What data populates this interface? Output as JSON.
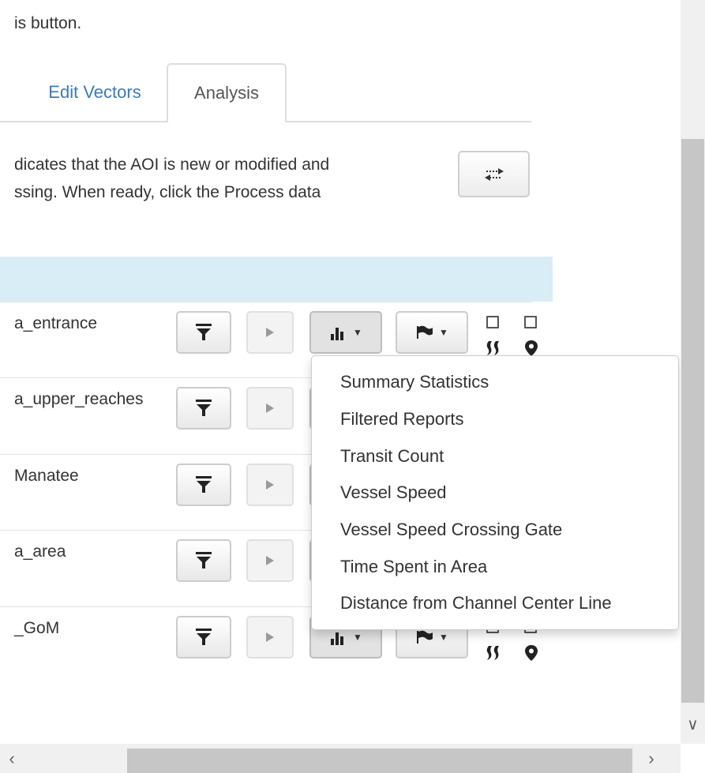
{
  "intro": {
    "text": "is button."
  },
  "tabs": [
    {
      "label": "Edit Vectors"
    },
    {
      "label": "Analysis"
    }
  ],
  "info": {
    "line1": "dicates that the AOI is new or modified and",
    "line2": "ssing. When ready, click the Process data"
  },
  "process_button": {
    "icon": "swap-arrows-icon"
  },
  "rows": [
    {
      "name": "a_entrance"
    },
    {
      "name": "a_upper_reaches"
    },
    {
      "name": "Manatee"
    },
    {
      "name": "a_area"
    },
    {
      "name": "_GoM"
    }
  ],
  "menu": {
    "items": [
      "Summary Statistics",
      "Filtered Reports",
      "Transit Count",
      "Vessel Speed",
      "Vessel Speed Crossing Gate",
      "Time Spent in Area",
      "Distance from Channel Center Line"
    ]
  },
  "icons": {
    "filter": "filter-icon",
    "play": "play-icon",
    "chart": "bar-chart-icon",
    "flag": "flag-icon",
    "heat": "heat-icon",
    "marker": "map-marker-icon"
  },
  "colors": {
    "link": "#3a7bbf",
    "header_bg": "#d9edf7",
    "text": "#333333"
  }
}
